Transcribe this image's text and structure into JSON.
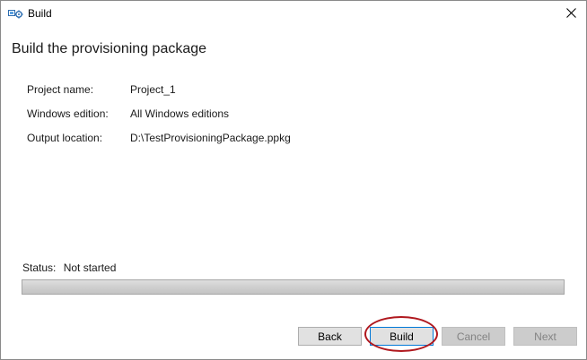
{
  "window": {
    "title": "Build",
    "icon": "provisioning-package-icon",
    "close_icon": "close-icon"
  },
  "page": {
    "heading": "Build the provisioning package"
  },
  "info": {
    "rows": [
      {
        "label": "Project name:",
        "value": "Project_1"
      },
      {
        "label": "Windows edition:",
        "value": "All Windows editions"
      },
      {
        "label": "Output location:",
        "value": "D:\\TestProvisioningPackage.ppkg"
      }
    ]
  },
  "status": {
    "label": "Status:",
    "value": "Not started",
    "progress": 0
  },
  "buttons": {
    "back": {
      "label": "Back",
      "enabled": true
    },
    "build": {
      "label": "Build",
      "enabled": true,
      "focused": true
    },
    "cancel": {
      "label": "Cancel",
      "enabled": false
    },
    "next": {
      "label": "Next",
      "enabled": false
    }
  },
  "annotation": {
    "highlight_color": "#b0181e",
    "highlight_target": "build-button"
  },
  "colors": {
    "progress_track": "#cfcfcf",
    "button_face": "#e1e1e1",
    "button_focus_border": "#0078d7"
  }
}
